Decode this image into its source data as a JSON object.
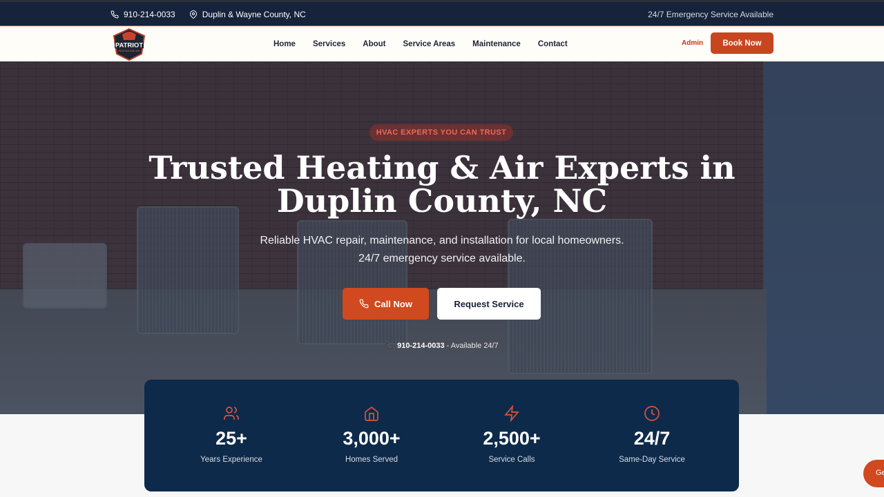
{
  "topbar": {
    "phone": "910-214-0033",
    "location": "Duplin & Wayne County, NC",
    "emergency": "24/7 Emergency Service Available"
  },
  "nav": {
    "logo_text": "PATRIOT",
    "logo_subtext": "HEATING AND AIR",
    "items": [
      "Home",
      "Services",
      "About",
      "Service Areas",
      "Maintenance",
      "Contact"
    ],
    "admin": "Admin",
    "book": "Book Now"
  },
  "hero": {
    "badge": "HVAC EXPERTS YOU CAN TRUST",
    "title_line1": "Trusted Heating & Air Experts in",
    "title_line2": "Duplin County, NC",
    "subtitle_line1": "Reliable HVAC repair, maintenance, and installation for local homeowners.",
    "subtitle_line2": "24/7 emergency service available.",
    "call_btn": "Call Now",
    "request_btn": "Request Service",
    "avail_phone": "910-214-0033",
    "avail_text": " - Available 24/7"
  },
  "stats": [
    {
      "icon": "users-icon",
      "value": "25+",
      "label": "Years Experience"
    },
    {
      "icon": "home-icon",
      "value": "3,000+",
      "label": "Homes Served"
    },
    {
      "icon": "lightning-icon",
      "value": "2,500+",
      "label": "Service Calls"
    },
    {
      "icon": "clock-icon",
      "value": "24/7",
      "label": "Same-Day Service"
    }
  ],
  "chat": {
    "label": "Ge"
  },
  "colors": {
    "accent": "#d1491f",
    "navy": "#0e2a4a",
    "topbar": "#16233a"
  }
}
